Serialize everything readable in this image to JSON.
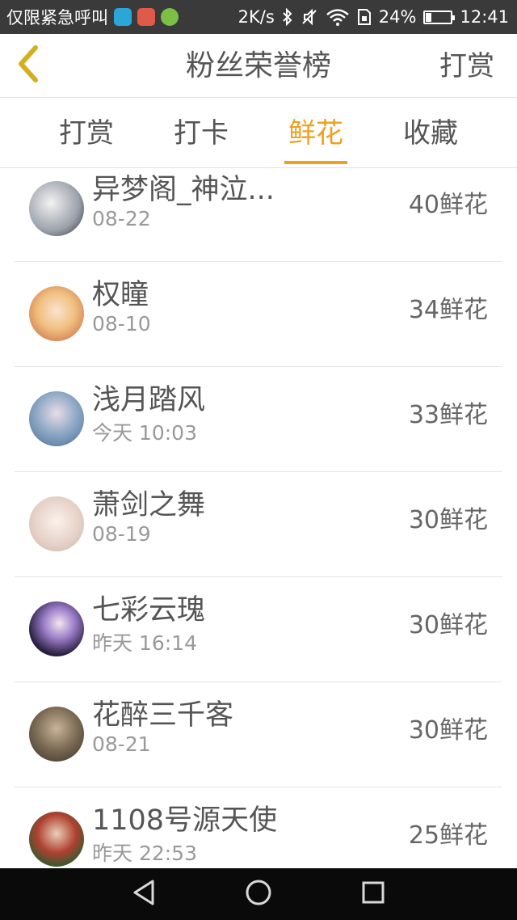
{
  "status_bar": {
    "left_text": "仅限紧急呼叫",
    "speed": "2K/s",
    "battery": "24%",
    "battery_level": 0.24,
    "time": "12:41",
    "app_icons": [
      {
        "name": "app-icon-blue",
        "color": "#2aa7d6"
      },
      {
        "name": "app-icon-red",
        "color": "#e05a4a"
      },
      {
        "name": "app-icon-green",
        "color": "#7cbf45"
      }
    ]
  },
  "header": {
    "back_icon": "chevron-left-icon",
    "title": "粉丝荣誉榜",
    "action": "打赏"
  },
  "tabs": [
    {
      "label": "打赏",
      "active": false
    },
    {
      "label": "打卡",
      "active": false
    },
    {
      "label": "鲜花",
      "active": true
    },
    {
      "label": "收藏",
      "active": false
    }
  ],
  "list": [
    {
      "name": "异梦阁_神泣...",
      "time": "08-22",
      "value": "40鲜花",
      "avatar_color": "#b8bcc4"
    },
    {
      "name": "权瞳",
      "time": "08-10",
      "value": "34鲜花",
      "avatar_color": "#f0c89a"
    },
    {
      "name": "浅月踏风",
      "time": "今天 10:03",
      "value": "33鲜花",
      "avatar_color": "#7d9bb8"
    },
    {
      "name": "萧剑之舞",
      "time": "08-19",
      "value": "30鲜花",
      "avatar_color": "#e8d6cc"
    },
    {
      "name": "七彩云瑰",
      "time": "昨天 16:14",
      "value": "30鲜花",
      "avatar_color": "#3a3050"
    },
    {
      "name": "花醉三千客",
      "time": "08-21",
      "value": "30鲜花",
      "avatar_color": "#6a5a48"
    },
    {
      "name": "1108号源天使",
      "time": "昨天 22:53",
      "value": "25鲜花",
      "avatar_color": "#4a6a40"
    }
  ],
  "colors": {
    "accent": "#f0a020",
    "status_bar": "#3a3a3a",
    "nav_bar": "#0a0a0a"
  },
  "nav_bar": {
    "back": "triangle-back-icon",
    "home": "circle-home-icon",
    "recents": "square-recents-icon"
  }
}
